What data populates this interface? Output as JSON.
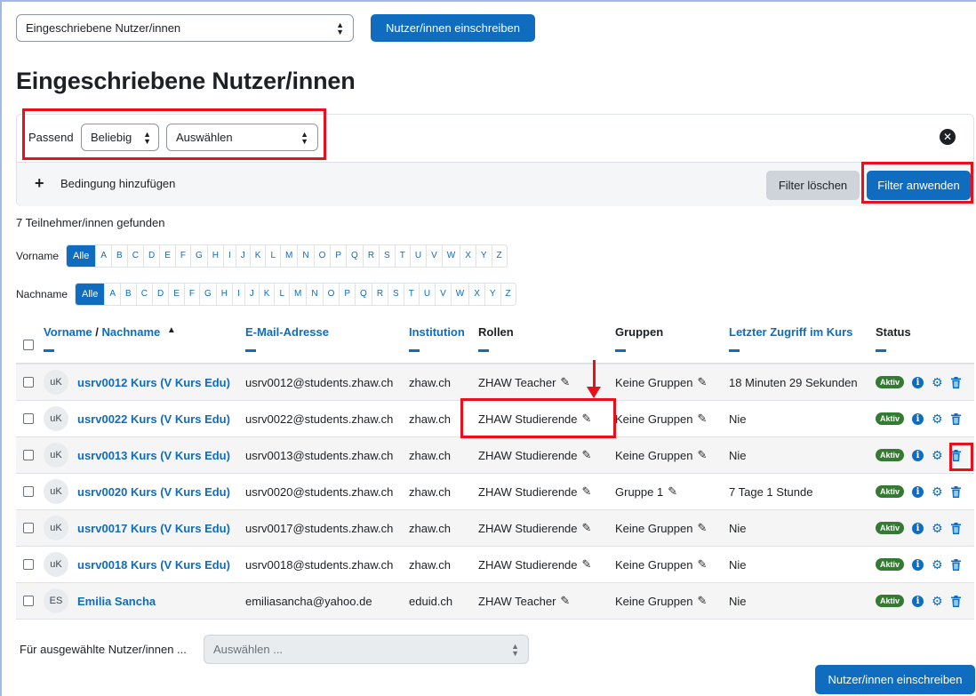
{
  "header": {
    "select_value": "Eingeschriebene Nutzer/innen",
    "enrol_button": "Nutzer/innen einschreiben"
  },
  "page_title": "Eingeschriebene Nutzer/innen",
  "filter": {
    "match_label": "Passend",
    "match_value": "Beliebig",
    "type_value": "Auswählen",
    "add_condition": "Bedingung hinzufügen",
    "clear_button": "Filter löschen",
    "apply_button": "Filter anwenden"
  },
  "count_text": "7 Teilnehmer/innen gefunden",
  "initials": {
    "firstname_label": "Vorname",
    "lastname_label": "Nachname",
    "all_label": "Alle",
    "letters": [
      "A",
      "B",
      "C",
      "D",
      "E",
      "F",
      "G",
      "H",
      "I",
      "J",
      "K",
      "L",
      "M",
      "N",
      "O",
      "P",
      "Q",
      "R",
      "S",
      "T",
      "U",
      "V",
      "W",
      "X",
      "Y",
      "Z"
    ]
  },
  "table": {
    "headers": {
      "firstname": "Vorname",
      "separator": " / ",
      "lastname": "Nachname",
      "sort_indicator": "▲",
      "email": "E-Mail-Adresse",
      "institution": "Institution",
      "roles": "Rollen",
      "groups": "Gruppen",
      "last_access": "Letzter Zugriff im Kurs",
      "status": "Status"
    },
    "rows": [
      {
        "initials": "uK",
        "name": "usrv0012 Kurs (V Kurs Edu)",
        "email": "usrv0012@students.zhaw.ch",
        "institution": "zhaw.ch",
        "role": "ZHAW Teacher",
        "group": "Keine Gruppen",
        "last_access": "18 Minuten 29 Sekunden",
        "status": "Aktiv"
      },
      {
        "initials": "uK",
        "name": "usrv0022 Kurs (V Kurs Edu)",
        "email": "usrv0022@students.zhaw.ch",
        "institution": "zhaw.ch",
        "role": "ZHAW Studierende",
        "group": "Keine Gruppen",
        "last_access": "Nie",
        "status": "Aktiv"
      },
      {
        "initials": "uK",
        "name": "usrv0013 Kurs (V Kurs Edu)",
        "email": "usrv0013@students.zhaw.ch",
        "institution": "zhaw.ch",
        "role": "ZHAW Studierende",
        "group": "Keine Gruppen",
        "last_access": "Nie",
        "status": "Aktiv"
      },
      {
        "initials": "uK",
        "name": "usrv0020 Kurs (V Kurs Edu)",
        "email": "usrv0020@students.zhaw.ch",
        "institution": "zhaw.ch",
        "role": "ZHAW Studierende",
        "group": "Gruppe 1",
        "last_access": "7 Tage 1 Stunde",
        "status": "Aktiv"
      },
      {
        "initials": "uK",
        "name": "usrv0017 Kurs (V Kurs Edu)",
        "email": "usrv0017@students.zhaw.ch",
        "institution": "zhaw.ch",
        "role": "ZHAW Studierende",
        "group": "Keine Gruppen",
        "last_access": "Nie",
        "status": "Aktiv"
      },
      {
        "initials": "uK",
        "name": "usrv0018 Kurs (V Kurs Edu)",
        "email": "usrv0018@students.zhaw.ch",
        "institution": "zhaw.ch",
        "role": "ZHAW Studierende",
        "group": "Keine Gruppen",
        "last_access": "Nie",
        "status": "Aktiv"
      },
      {
        "initials": "ES",
        "name": "Emilia Sancha",
        "email": "emiliasancha@yahoo.de",
        "institution": "eduid.ch",
        "role": "ZHAW Teacher",
        "group": "Keine Gruppen",
        "last_access": "Nie",
        "status": "Aktiv"
      }
    ]
  },
  "bulk": {
    "label": "Für ausgewählte Nutzer/innen ...",
    "select_placeholder": "Auswählen ...",
    "enrol_button": "Nutzer/innen einschreiben"
  },
  "icons": {
    "pencil": "pencil-icon",
    "info": "info-icon",
    "gear": "gear-icon",
    "trash": "trash-icon",
    "close": "close-circle-icon",
    "plus": "plus-icon"
  },
  "colors": {
    "primary": "#0f6cbf",
    "active_badge": "#357a32",
    "highlight": "#e8101a"
  }
}
